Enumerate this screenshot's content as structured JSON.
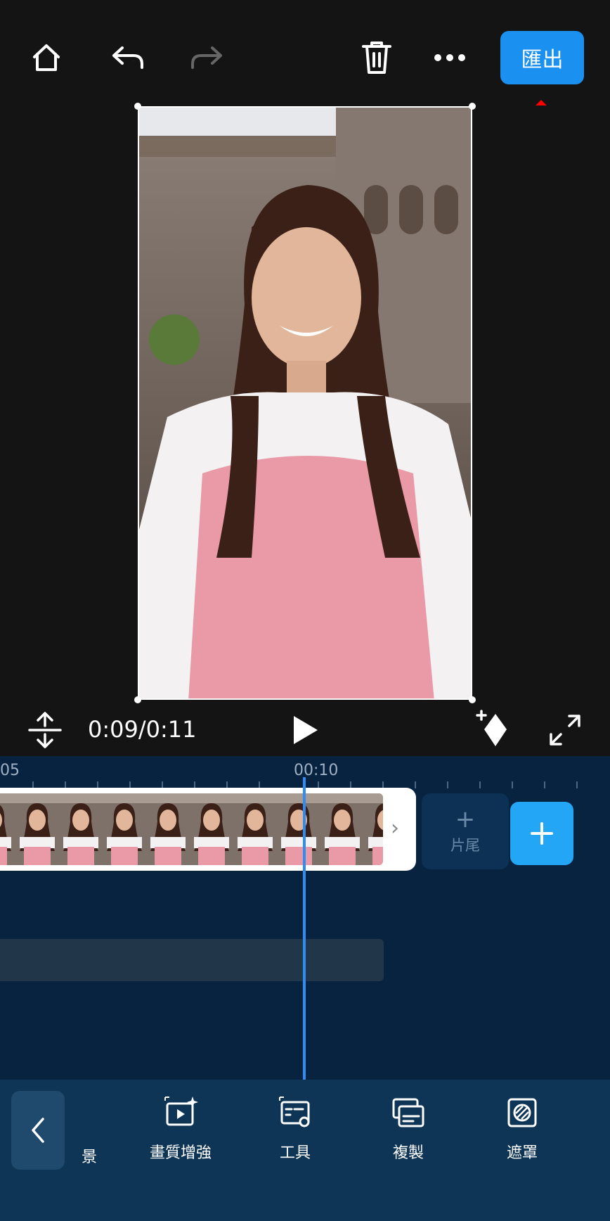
{
  "toolbar": {
    "export_label": "匯出"
  },
  "playback": {
    "timecode": "0:09/0:11"
  },
  "timeline": {
    "ruler_labels": [
      "05",
      "00:10"
    ],
    "ending_label": "片尾"
  },
  "bottom_tools": {
    "partial_label": "景",
    "items": [
      {
        "label": "畫質增強",
        "icon": "enhance-icon"
      },
      {
        "label": "工具",
        "icon": "tools-icon"
      },
      {
        "label": "複製",
        "icon": "duplicate-icon"
      },
      {
        "label": "遮罩",
        "icon": "mask-icon"
      }
    ]
  },
  "colors": {
    "accent": "#1a90f0",
    "timeline_bg": "#07233f",
    "toolbar_bg": "#0e3556",
    "playhead": "#2f8cf0",
    "annotation_arrow": "#ff0000"
  }
}
